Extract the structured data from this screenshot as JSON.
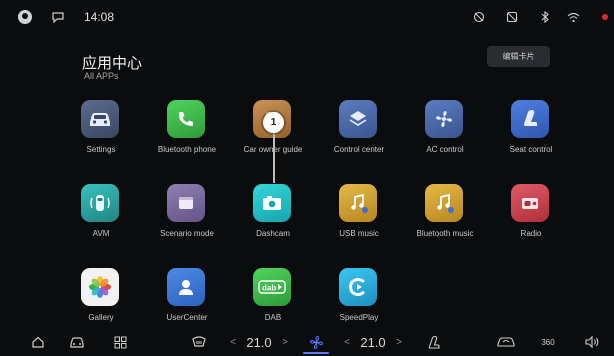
{
  "status_bar": {
    "time": "14:08",
    "icons": [
      "avatar-icon",
      "message-icon",
      "no-camera-icon",
      "no-signal-icon",
      "bluetooth-icon",
      "wifi-icon"
    ],
    "notification_color": "#e02a2a"
  },
  "header": {
    "title": "应用中心",
    "subtitle": "All APPs",
    "edit_button": "编辑卡片"
  },
  "apps": [
    {
      "label": "Settings",
      "icon": "car-settings-icon",
      "color": "#4a5a78"
    },
    {
      "label": "Bluetooth phone",
      "icon": "phone-icon",
      "color": "#3fb24a"
    },
    {
      "label": "Car owner guide",
      "icon": "book-icon",
      "color": "#b07a3e"
    },
    {
      "label": "Control center",
      "icon": "layers-icon",
      "color": "#4b6aa8"
    },
    {
      "label": "AC control",
      "icon": "fan-icon",
      "color": "#4b6aa8"
    },
    {
      "label": "Seat control",
      "icon": "seat-icon",
      "color": "#3f68c8"
    },
    {
      "label": "AVM",
      "icon": "car-topview-icon",
      "color": "#2fa6a4"
    },
    {
      "label": "Scenario mode",
      "icon": "scenario-icon",
      "color": "#7a6a9e"
    },
    {
      "label": "Dashcam",
      "icon": "camera-icon",
      "color": "#1fc2c8"
    },
    {
      "label": "USB music",
      "icon": "usb-music-icon",
      "color": "#d4a532"
    },
    {
      "label": "Bluetooth music",
      "icon": "bt-music-icon",
      "color": "#d4a532"
    },
    {
      "label": "Radio",
      "icon": "radio-icon",
      "color": "#d24a56"
    },
    {
      "label": "Gallery",
      "icon": "gallery-icon",
      "color": "#f0f0f0"
    },
    {
      "label": "UserCenter",
      "icon": "user-icon",
      "color": "#3a7ad8"
    },
    {
      "label": "DAB",
      "icon": "dab-icon",
      "color": "#3fb24a"
    },
    {
      "label": "SpeedPlay",
      "icon": "speedplay-icon",
      "color": "#2fb5e0"
    }
  ],
  "marker": {
    "number": "1"
  },
  "dock": {
    "left_temp": "21.0",
    "right_temp": "21.0",
    "chevron_left": "<",
    "chevron_right": ">",
    "icons": [
      "home-icon",
      "car-icon",
      "apps-grid-icon",
      "rear-defrost-icon",
      "fan-active-icon",
      "seat-heat-icon",
      "recirc-icon",
      "camera-360-icon",
      "volume-icon"
    ],
    "label_360": "360",
    "accent": "#5a7cff"
  }
}
